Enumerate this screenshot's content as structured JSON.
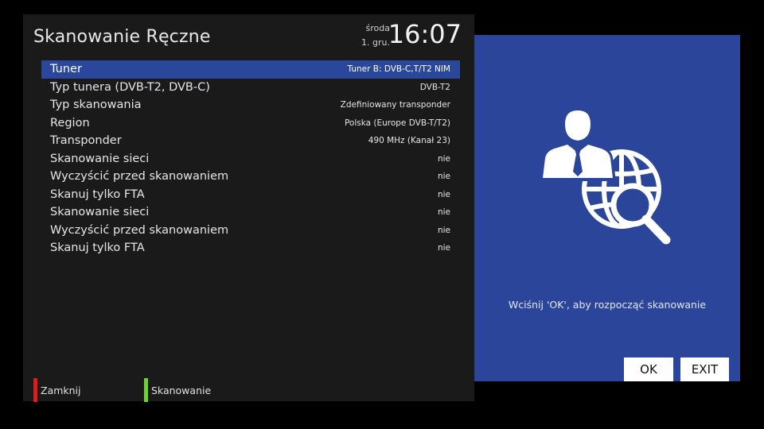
{
  "header": {
    "title": "Skanowanie Ręczne",
    "day": "środa",
    "date": "1. gru.",
    "time": "16:07"
  },
  "menu": [
    {
      "label": "Tuner",
      "value": "Tuner B: DVB-C,T/T2 NIM",
      "selected": true
    },
    {
      "label": "Typ tunera (DVB-T2, DVB-C)",
      "value": "DVB-T2"
    },
    {
      "label": "Typ skanowania",
      "value": "Zdefiniowany transponder"
    },
    {
      "label": "Region",
      "value": "Polska (Europe DVB-T/T2)"
    },
    {
      "label": "Transponder",
      "value": "490 MHz  (Kanał 23)"
    },
    {
      "label": "Skanowanie sieci",
      "value": "nie"
    },
    {
      "label": "Wyczyścić przed skanowaniem",
      "value": "nie"
    },
    {
      "label": "Skanuj tylko FTA",
      "value": "nie"
    },
    {
      "label": "Skanowanie sieci",
      "value": "nie"
    },
    {
      "label": "Wyczyścić przed skanowaniem",
      "value": "nie"
    },
    {
      "label": "Skanuj tylko FTA",
      "value": "nie"
    }
  ],
  "footer": {
    "red_label": "Zamknij",
    "green_label": "Skanowanie",
    "red_color": "#e01b1b",
    "green_color": "#6ed32a"
  },
  "info_panel": {
    "hint": "Wciśnij 'OK', aby rozpocząć skanowanie",
    "ok_label": "OK",
    "exit_label": "EXIT",
    "accent_color": "#2a459a",
    "icons": [
      "user-icon",
      "globe-icon",
      "magnifier-icon"
    ]
  }
}
